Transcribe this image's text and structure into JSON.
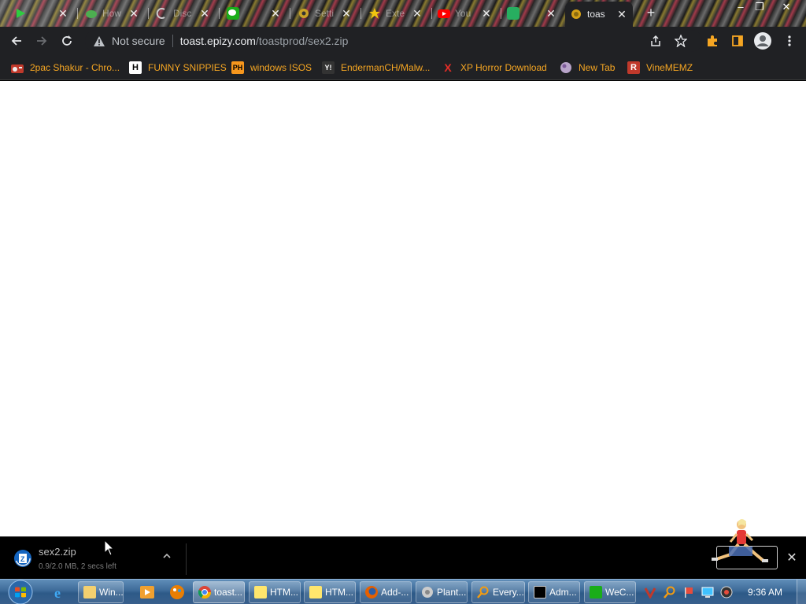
{
  "browser": {
    "tabs": [
      {
        "label": "",
        "icon": "green-play-icon"
      },
      {
        "label": "How",
        "icon": "green-frog-icon"
      },
      {
        "label": "Disc",
        "icon": "discord-icon"
      },
      {
        "label": "",
        "icon": "wechat-icon"
      },
      {
        "label": "Setti",
        "icon": "gear-icon"
      },
      {
        "label": "Exte",
        "icon": "puzzle-icon"
      },
      {
        "label": "You",
        "icon": "youtube-icon"
      },
      {
        "label": "",
        "icon": "green-square-icon"
      },
      {
        "label": "toas",
        "icon": "toast-icon",
        "active": true
      }
    ],
    "new_tab_label": "+",
    "window_controls": {
      "minimize": "–",
      "restore": "❐",
      "close": "✕"
    },
    "toolbar": {
      "security_label": "Not secure",
      "url_host": "toast.epizy.com",
      "url_path": "/toastprod/sex2.zip"
    },
    "bookmarks": [
      {
        "label": "2pac Shakur - Chro...",
        "icon": "radio-icon"
      },
      {
        "label": "FUNNY SNIPPIES",
        "icon": "h-logo-icon",
        "icon_text": "H"
      },
      {
        "label": "windows ISOS",
        "icon": "ph-logo-icon",
        "icon_text": "PH"
      },
      {
        "label": "EndermanCH/Malw...",
        "icon": "yp-logo-icon",
        "icon_text": "Y!"
      },
      {
        "label": "XP Horror Download",
        "icon": "x-logo-icon",
        "icon_text": "X"
      },
      {
        "label": "New Tab",
        "icon": "globe-icon"
      },
      {
        "label": "VineMEMZ",
        "icon": "r-logo-icon",
        "icon_text": "R"
      }
    ],
    "colors": {
      "bookmark_text": "#f5a623",
      "toolbar_bg": "#202124",
      "page_bg": "#ffffff"
    }
  },
  "download_shelf": {
    "filename": "sex2.zip",
    "status": "0.9/2.0 MB, 2 secs left",
    "progress": 0.45,
    "close_label": "✕"
  },
  "taskbar": {
    "tasks": [
      {
        "label": "Win...",
        "icon": "explorer-folder-icon"
      },
      {
        "label": "toast...",
        "icon": "chrome-icon",
        "active": true
      },
      {
        "label": "HTM...",
        "icon": "help-icon"
      },
      {
        "label": "HTM...",
        "icon": "help-icon"
      },
      {
        "label": "Add-...",
        "icon": "firefox-icon"
      },
      {
        "label": "Plant...",
        "icon": "plant-icon"
      },
      {
        "label": "Every...",
        "icon": "search-everything-icon"
      },
      {
        "label": "Adm...",
        "icon": "cmd-icon"
      },
      {
        "label": "WeC...",
        "icon": "wechat-icon"
      }
    ],
    "clock": "9:36 AM"
  }
}
